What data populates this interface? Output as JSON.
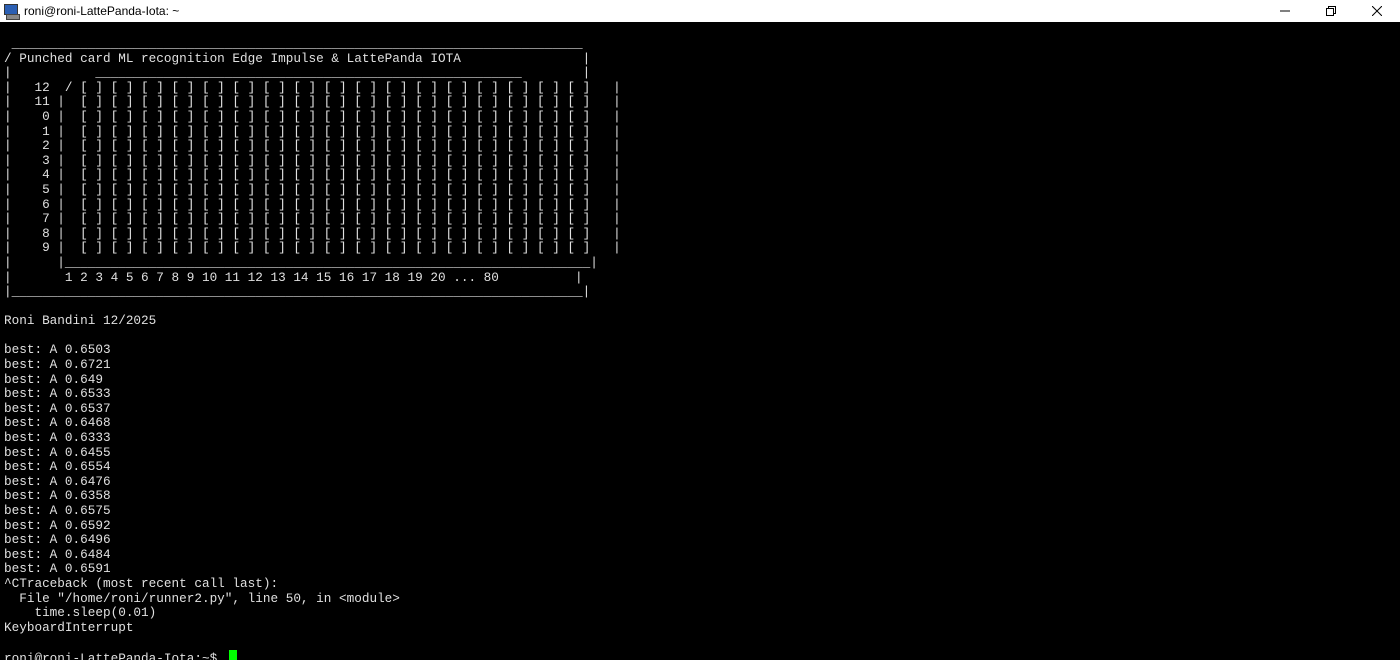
{
  "window": {
    "title": "roni@roni-LattePanda-Iota: ~",
    "icon": "putty-terminal-icon",
    "controls": [
      "minimize-icon",
      "restore-icon",
      "close-icon"
    ]
  },
  "terminal": {
    "fg_color": "#e0e0e0",
    "bg_color": "#000000",
    "cursor_color": "#00ff00",
    "lines": [
      " ___________________________________________________________________________",
      "/ Punched card ML recognition Edge Impulse & LattePanda IOTA                |",
      "|           ________________________________________________________        |",
      "|   12  / [ ] [ ] [ ] [ ] [ ] [ ] [ ] [ ] [ ] [ ] [ ] [ ] [ ] [ ] [ ] [ ] [ ]   |",
      "|   11 |  [ ] [ ] [ ] [ ] [ ] [ ] [ ] [ ] [ ] [ ] [ ] [ ] [ ] [ ] [ ] [ ] [ ]   |",
      "|    0 |  [ ] [ ] [ ] [ ] [ ] [ ] [ ] [ ] [ ] [ ] [ ] [ ] [ ] [ ] [ ] [ ] [ ]   |",
      "|    1 |  [ ] [ ] [ ] [ ] [ ] [ ] [ ] [ ] [ ] [ ] [ ] [ ] [ ] [ ] [ ] [ ] [ ]   |",
      "|    2 |  [ ] [ ] [ ] [ ] [ ] [ ] [ ] [ ] [ ] [ ] [ ] [ ] [ ] [ ] [ ] [ ] [ ]   |",
      "|    3 |  [ ] [ ] [ ] [ ] [ ] [ ] [ ] [ ] [ ] [ ] [ ] [ ] [ ] [ ] [ ] [ ] [ ]   |",
      "|    4 |  [ ] [ ] [ ] [ ] [ ] [ ] [ ] [ ] [ ] [ ] [ ] [ ] [ ] [ ] [ ] [ ] [ ]   |",
      "|    5 |  [ ] [ ] [ ] [ ] [ ] [ ] [ ] [ ] [ ] [ ] [ ] [ ] [ ] [ ] [ ] [ ] [ ]   |",
      "|    6 |  [ ] [ ] [ ] [ ] [ ] [ ] [ ] [ ] [ ] [ ] [ ] [ ] [ ] [ ] [ ] [ ] [ ]   |",
      "|    7 |  [ ] [ ] [ ] [ ] [ ] [ ] [ ] [ ] [ ] [ ] [ ] [ ] [ ] [ ] [ ] [ ] [ ]   |",
      "|    8 |  [ ] [ ] [ ] [ ] [ ] [ ] [ ] [ ] [ ] [ ] [ ] [ ] [ ] [ ] [ ] [ ] [ ]   |",
      "|    9 |  [ ] [ ] [ ] [ ] [ ] [ ] [ ] [ ] [ ] [ ] [ ] [ ] [ ] [ ] [ ] [ ] [ ]   |",
      "|      |_____________________________________________________________________|",
      "|       1 2 3 4 5 6 7 8 9 10 11 12 13 14 15 16 17 18 19 20 ... 80          |",
      "|___________________________________________________________________________|",
      "",
      "Roni Bandini 12/2025",
      "",
      "best: A 0.6503",
      "best: A 0.6721",
      "best: A 0.649",
      "best: A 0.6533",
      "best: A 0.6537",
      "best: A 0.6468",
      "best: A 0.6333",
      "best: A 0.6455",
      "best: A 0.6554",
      "best: A 0.6476",
      "best: A 0.6358",
      "best: A 0.6575",
      "best: A 0.6592",
      "best: A 0.6496",
      "best: A 0.6484",
      "best: A 0.6591",
      "^CTraceback (most recent call last):",
      "  File \"/home/roni/runner2.py\", line 50, in <module>",
      "    time.sleep(0.01)",
      "KeyboardInterrupt",
      ""
    ],
    "prompt": "roni@roni-LattePanda-Iota:~$ "
  }
}
